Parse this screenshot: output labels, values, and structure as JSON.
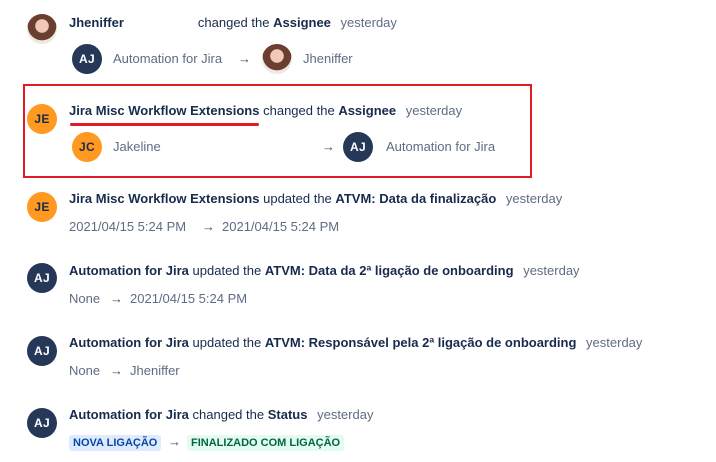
{
  "arrow": "→",
  "entries": [
    {
      "actor": "Jheniffer",
      "verb": "changed the",
      "field": "Assignee",
      "time": "yesterday",
      "from": {
        "avatar": "AJ",
        "name": "Automation for Jira"
      },
      "to": {
        "avatar": "photo",
        "name": "Jheniffer"
      }
    },
    {
      "actor_initials": "JE",
      "actor": "Jira Misc Workflow Extensions",
      "verb": "changed the",
      "field": "Assignee",
      "time": "yesterday",
      "from": {
        "avatar": "JC",
        "name": "Jakeline"
      },
      "to": {
        "avatar": "AJ",
        "name": "Automation for Jira"
      }
    },
    {
      "actor_initials": "JE",
      "actor": "Jira Misc Workflow Extensions",
      "verb": "updated the",
      "field": "ATVM: Data da finalização",
      "time": "yesterday",
      "from_text": "2021/04/15 5:24 PM",
      "to_text": "2021/04/15 5:24 PM"
    },
    {
      "actor_initials": "AJ",
      "actor": "Automation for Jira",
      "verb": "updated the",
      "field": "ATVM: Data da 2ª ligação de onboarding",
      "time": "yesterday",
      "from_text": "None",
      "to_text": "2021/04/15 5:24 PM"
    },
    {
      "actor_initials": "AJ",
      "actor": "Automation for Jira",
      "verb": "updated the",
      "field": "ATVM: Responsável pela 2ª ligação de onboarding",
      "time": "yesterday",
      "from_text": "None",
      "to_text": "Jheniffer"
    },
    {
      "actor_initials": "AJ",
      "actor": "Automation for Jira",
      "verb": "changed the",
      "field": "Status",
      "time": "yesterday",
      "from_status": "NOVA LIGAÇÃO",
      "to_status": "FINALIZADO COM LIGAÇÃO"
    }
  ],
  "colors": {
    "highlight": "#e01b24",
    "avatar_aj": "#253858",
    "avatar_orange": "#ff991f",
    "lozenge_blue_bg": "#deebff",
    "lozenge_green_bg": "#e3fcef"
  }
}
